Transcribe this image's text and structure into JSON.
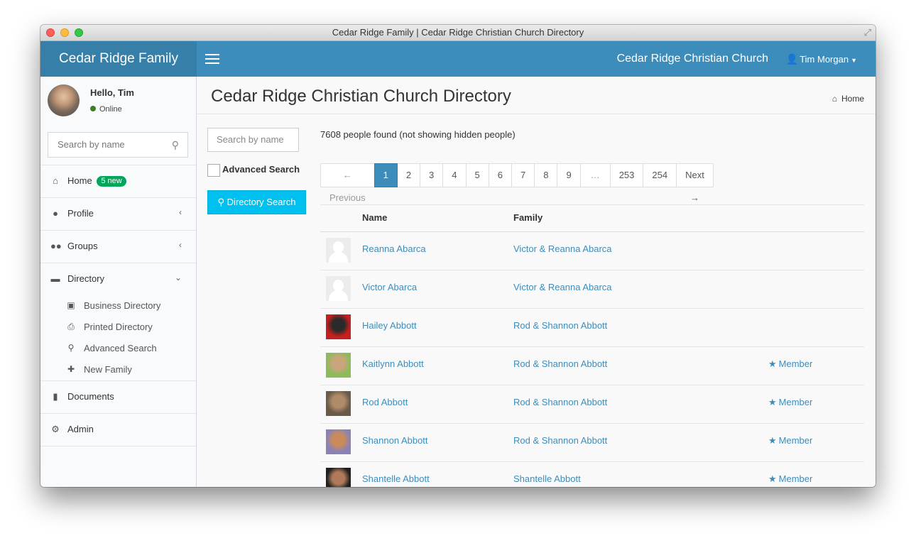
{
  "window": {
    "title": "Cedar Ridge Family | Cedar Ridge Christian Church Directory"
  },
  "topbar": {
    "brand": "Cedar Ridge Family",
    "church_name": "Cedar Ridge Christian Church",
    "user_name": "Tim Morgan"
  },
  "sidebar": {
    "greeting": "Hello, Tim",
    "status": "Online",
    "search_placeholder": "Search by name",
    "items": [
      {
        "label": "Home",
        "badge": "5 new",
        "icon": "home-icon"
      },
      {
        "label": "Profile",
        "icon": "user-icon"
      },
      {
        "label": "Groups",
        "icon": "users-icon"
      },
      {
        "label": "Directory",
        "icon": "archive-icon"
      },
      {
        "label": "Documents",
        "icon": "file-icon"
      },
      {
        "label": "Admin",
        "icon": "gears-icon"
      }
    ],
    "directory_submenu": [
      {
        "label": "Business Directory",
        "icon": "briefcase-icon"
      },
      {
        "label": "Printed Directory",
        "icon": "print-icon"
      },
      {
        "label": "Advanced Search",
        "icon": "search-icon"
      },
      {
        "label": "New Family",
        "icon": "plus-icon"
      }
    ]
  },
  "content": {
    "page_title": "Cedar Ridge Christian Church Directory",
    "breadcrumb": "Home",
    "search": {
      "placeholder": "Search by name",
      "advanced_label": "Advanced Search",
      "button_label": "Directory Search"
    },
    "results_count": "7608 people found (not showing hidden people)",
    "pagination": {
      "previous": "← Previous",
      "pages": [
        "1",
        "2",
        "3",
        "4",
        "5",
        "6",
        "7",
        "8",
        "9",
        "…",
        "253",
        "254"
      ],
      "current": "1",
      "next": "Next →"
    },
    "table": {
      "columns": [
        "Name",
        "Family"
      ],
      "rows": [
        {
          "name": "Reanna Abarca",
          "family": "Victor & Reanna Abarca",
          "member": "",
          "photo": "blank",
          "colors": [
            "#ffffff",
            "#ffffff"
          ]
        },
        {
          "name": "Victor Abarca",
          "family": "Victor & Reanna Abarca",
          "member": "",
          "photo": "blank",
          "colors": [
            "#ffffff",
            "#ffffff"
          ]
        },
        {
          "name": "Hailey Abbott",
          "family": "Rod & Shannon Abbott",
          "member": "",
          "photo": "photo",
          "colors": [
            "#c61f1f",
            "#2a2a2a"
          ]
        },
        {
          "name": "Kaitlynn Abbott",
          "family": "Rod & Shannon Abbott",
          "member": "Member",
          "photo": "photo",
          "colors": [
            "#8dbb5a",
            "#c9a57c"
          ]
        },
        {
          "name": "Rod Abbott",
          "family": "Rod & Shannon Abbott",
          "member": "Member",
          "photo": "photo",
          "colors": [
            "#6b5a48",
            "#b08b6a"
          ]
        },
        {
          "name": "Shannon Abbott",
          "family": "Rod & Shannon Abbott",
          "member": "Member",
          "photo": "photo",
          "colors": [
            "#8a82b5",
            "#c98b5a"
          ]
        },
        {
          "name": "Shantelle Abbott",
          "family": "Shantelle Abbott",
          "member": "Member",
          "photo": "photo",
          "colors": [
            "#1f1f1f",
            "#b07a5a"
          ]
        }
      ]
    }
  }
}
